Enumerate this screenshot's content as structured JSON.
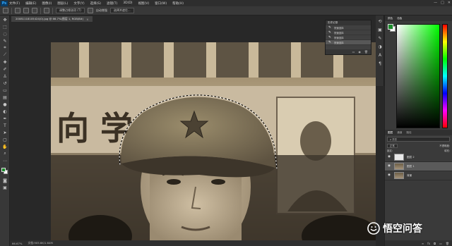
{
  "app": {
    "logo_text": "Ps"
  },
  "menubar": {
    "items": [
      "文件(F)",
      "编辑(E)",
      "图像(I)",
      "图层(L)",
      "文字(Y)",
      "选择(S)",
      "滤镜(T)",
      "3D(D)",
      "视图(V)",
      "窗口(W)",
      "帮助(H)"
    ]
  },
  "window_controls": [
    "—",
    "□",
    "✕"
  ],
  "options_bar": {
    "btn_refine": "调整边缘选项 (T)",
    "label_auto": "自动增强",
    "btn_select_subject": "选择并遮住..."
  },
  "document": {
    "tab_title": "20081118105424(0).jpg @ 66.7%(图层 1, RGB/8#)",
    "close_icon": "✕"
  },
  "history_panel": {
    "title": "历史记录",
    "items": [
      "快速选择",
      "快速选择",
      "快速选择",
      "快速选择"
    ]
  },
  "color_panel": {
    "tabs": [
      "颜色",
      "色板"
    ],
    "fg_color": "#1a8a2a",
    "bg_color": "#ffffff"
  },
  "layers_panel": {
    "tabs": [
      "图层",
      "通道",
      "路径"
    ],
    "filter_placeholder": "ρ 类型",
    "blend_mode": "正常",
    "opacity_label": "不透明度:",
    "lock_label": "锁定:",
    "fill_label": "填充:",
    "layers": [
      {
        "name": "图层 2",
        "type": "blank",
        "selected": false
      },
      {
        "name": "图层 1",
        "type": "photo",
        "selected": true
      },
      {
        "name": "背景",
        "type": "photo",
        "selected": false
      }
    ]
  },
  "status_bar": {
    "zoom": "66.67%",
    "doc_info": "文档:905.6K/1.64M"
  },
  "watermark": {
    "text": "悟空问答"
  }
}
